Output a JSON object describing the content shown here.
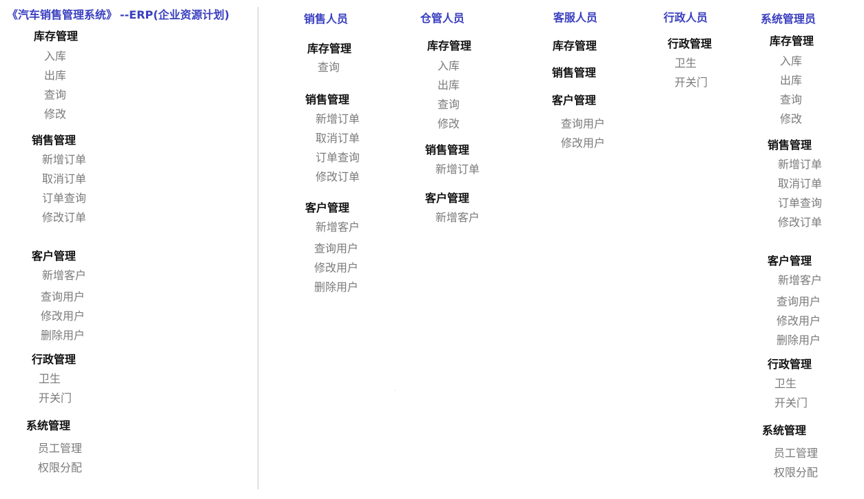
{
  "title": "《汽车销售管理系统》",
  "subtitle": "--ERP(企业资源计划)",
  "overview": {
    "inventory": {
      "label": "库存管理",
      "items": [
        "入库",
        "出库",
        "查询",
        "修改"
      ]
    },
    "sales": {
      "label": "销售管理",
      "items": [
        "新增订单",
        "取消订单",
        "订单查询",
        "修改订单"
      ]
    },
    "customer": {
      "label": "客户管理",
      "items": [
        "新增客户",
        "查询用户",
        "修改用户",
        "删除用户"
      ]
    },
    "admin": {
      "label": "行政管理",
      "items": [
        "卫生",
        "开关门"
      ]
    },
    "system": {
      "label": "系统管理",
      "items": [
        "员工管理",
        "权限分配"
      ]
    }
  },
  "roles": {
    "sales": {
      "name": "销售人员",
      "inventory": {
        "label": "库存管理",
        "items": [
          "查询"
        ]
      },
      "sales": {
        "label": "销售管理",
        "items": [
          "新增订单",
          "取消订单",
          "订单查询",
          "修改订单"
        ]
      },
      "customer": {
        "label": "客户管理",
        "items": [
          "新增客户",
          "查询用户",
          "修改用户",
          "删除用户"
        ]
      }
    },
    "warehouse": {
      "name": "仓管人员",
      "inventory": {
        "label": "库存管理",
        "items": [
          "入库",
          "出库",
          "查询",
          "修改"
        ]
      },
      "sales": {
        "label": "销售管理",
        "items": [
          "新增订单"
        ]
      },
      "customer": {
        "label": "客户管理",
        "items": [
          "新增客户"
        ]
      }
    },
    "service": {
      "name": "客服人员",
      "inventory": {
        "label": "库存管理"
      },
      "sales": {
        "label": "销售管理"
      },
      "customer": {
        "label": "客户管理",
        "items": [
          "查询用户",
          "修改用户"
        ]
      }
    },
    "admin": {
      "name": "行政人员",
      "admin": {
        "label": "行政管理",
        "items": [
          "卫生",
          "开关门"
        ]
      }
    },
    "sysadmin": {
      "name": "系统管理员",
      "inventory": {
        "label": "库存管理",
        "items": [
          "入库",
          "出库",
          "查询",
          "修改"
        ]
      },
      "sales": {
        "label": "销售管理",
        "items": [
          "新增订单",
          "取消订单",
          "订单查询",
          "修改订单"
        ]
      },
      "customer": {
        "label": "客户管理",
        "items": [
          "新增客户",
          "查询用户",
          "修改用户",
          "删除用户"
        ]
      },
      "admin": {
        "label": "行政管理",
        "items": [
          "卫生",
          "开关门"
        ]
      },
      "system": {
        "label": "系统管理",
        "items": [
          "员工管理",
          "权限分配"
        ]
      }
    }
  }
}
